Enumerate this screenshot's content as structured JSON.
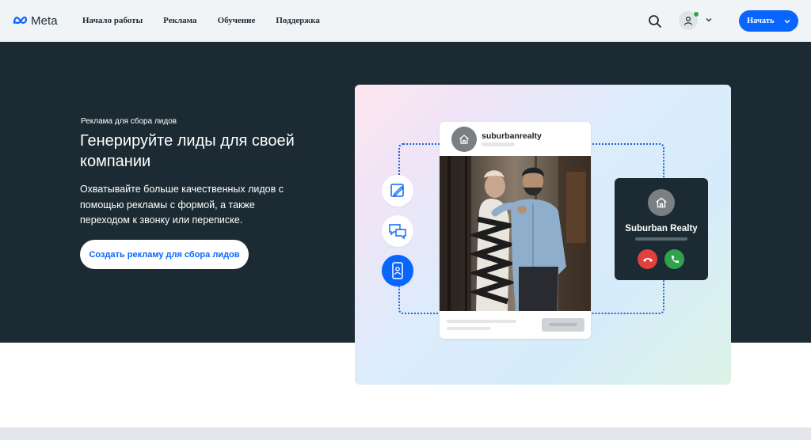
{
  "nav": {
    "logo_text": "Meta",
    "links": [
      "Начало работы",
      "Реклама",
      "Обучение",
      "Поддержка"
    ],
    "start_button": "Начать"
  },
  "hero": {
    "eyebrow": "Реклама для сбора лидов",
    "title": "Генерируйте лиды для своей компании",
    "description": "Охватывайте больше качественных лидов с помощью рекламы с формой, а также переходом к звонку или переписке.",
    "cta": "Создать рекламу для сбора лидов"
  },
  "illustration": {
    "post_account": "suburbanrealty",
    "call_name": "Suburban Realty",
    "icons": [
      "form-edit-icon",
      "chat-bubbles-icon",
      "phone-contact-icon"
    ]
  },
  "colors": {
    "accent": "#0866ff",
    "hero_bg": "#1c2b33",
    "decline": "#e0413d",
    "accept": "#31a24c"
  }
}
